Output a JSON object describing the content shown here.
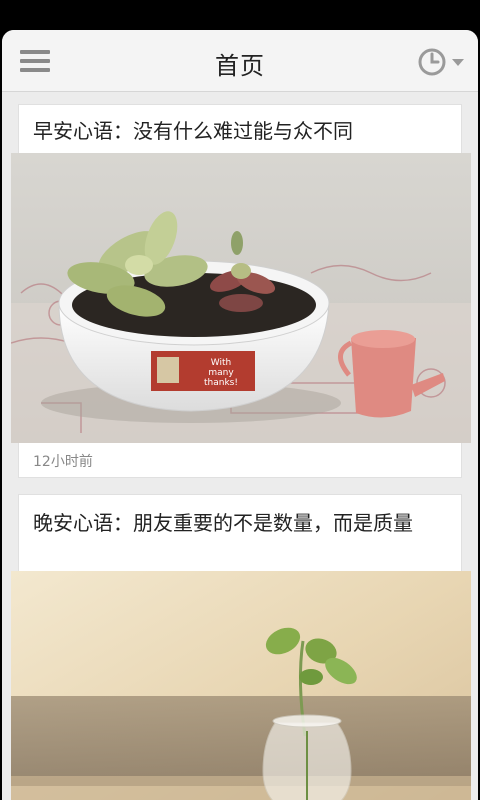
{
  "header": {
    "title": "首页",
    "menu_icon": "menu-icon",
    "history_icon": "clock-icon",
    "dropdown_icon": "triangle-down-icon"
  },
  "articles": [
    {
      "title": "早安心语：没有什么难过能与众不同",
      "timestamp": "12小时前",
      "image_text": [
        "With",
        "many",
        "thanks!"
      ]
    },
    {
      "title": "晚安心语：朋友重要的不是数量，而是质量"
    }
  ],
  "colors": {
    "background": "#ececec",
    "header": "#f4f4f4",
    "card": "#ffffff",
    "text": "#222222",
    "meta": "#888888",
    "icon": "#8a8a8a"
  }
}
